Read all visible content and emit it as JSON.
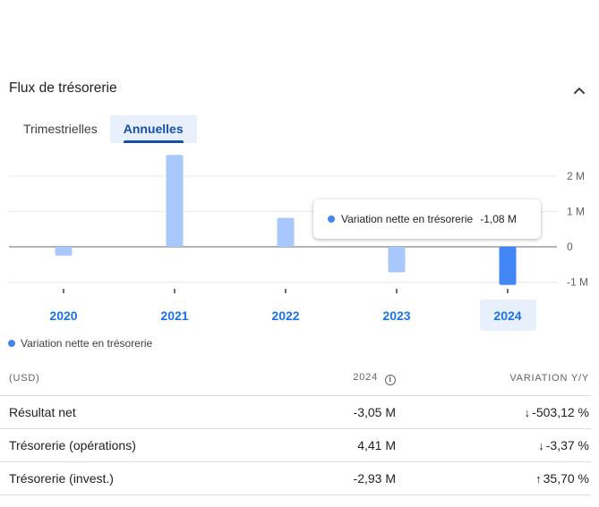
{
  "header": {
    "title": "Flux de trésorerie",
    "collapse_icon": "chevron-up-icon"
  },
  "tabs": [
    {
      "label": "Trimestrielles",
      "active": false
    },
    {
      "label": "Annuelles",
      "active": true
    }
  ],
  "chart_data": {
    "type": "bar",
    "categories": [
      "2020",
      "2021",
      "2022",
      "2023",
      "2024"
    ],
    "series": [
      {
        "name": "Variation nette en trésorerie",
        "values": [
          -0.25,
          2.6,
          0.82,
          -0.72,
          -1.08
        ]
      }
    ],
    "ylim": [
      -1,
      2
    ],
    "yticks": [
      "-1 M",
      "0",
      "1 M",
      "2 M"
    ],
    "selected_index": 4,
    "colors": {
      "bar": "#a8c7fa",
      "bar_selected": "#4285f4"
    }
  },
  "tooltip": {
    "label": "Variation nette en trésorerie",
    "value": "-1,08 M"
  },
  "legend": {
    "label": "Variation nette en trésorerie"
  },
  "table": {
    "headers": [
      "(USD)",
      "2024",
      "VARIATION Y/Y"
    ],
    "rows": [
      {
        "label": "Résultat net",
        "value": "-3,05 M",
        "change": "-503,12 %",
        "direction": "down"
      },
      {
        "label": "Trésorerie (opérations)",
        "value": "4,41 M",
        "change": "-3,37 %",
        "direction": "down"
      },
      {
        "label": "Trésorerie (invest.)",
        "value": "-2,93 M",
        "change": "35,70 %",
        "direction": "up"
      }
    ]
  }
}
